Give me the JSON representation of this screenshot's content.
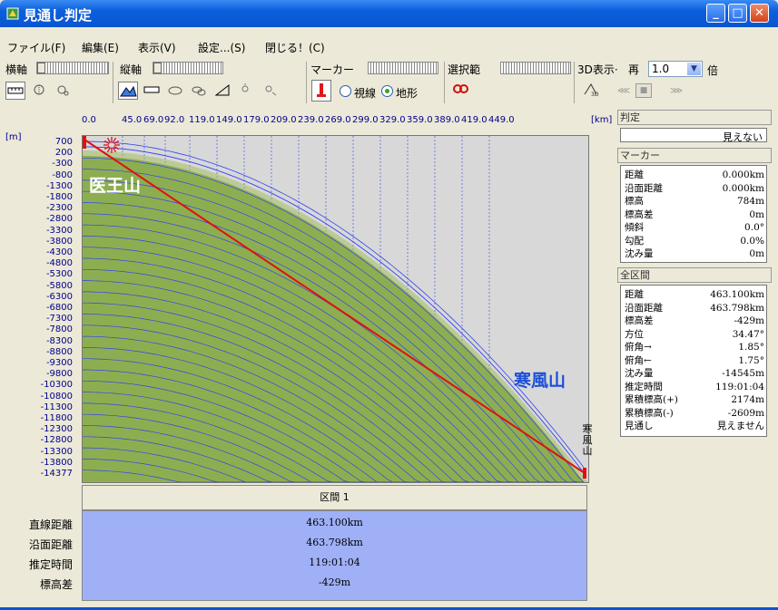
{
  "window": {
    "title": "見通し判定",
    "minimize": "_",
    "maximize": "□",
    "close": "✕"
  },
  "menu": [
    "ファイル(F)",
    "編集(E)",
    "表示(V)",
    "設定...(S)",
    "閉じる！(C)"
  ],
  "toolbar": {
    "h_axis_label": "横軸",
    "v_axis_label": "縦軸",
    "marker_label": "マーカー",
    "select_range_label": "選択範",
    "d3_label": "3D表示·",
    "replay_label": "再",
    "scale_value": "1.0",
    "scale_unit": "倍",
    "radio_line_of_sight": "視線",
    "radio_terrain": "地形",
    "radio_selected": "terrain"
  },
  "chart_data": {
    "type": "line",
    "x_unit": "[km]",
    "y_unit": "[m]",
    "x_ticks": [
      "0.0",
      "45.0",
      "69.0",
      "92.0",
      "119.0",
      "149.0",
      "179.0",
      "209.0",
      "239.0",
      "269.0",
      "299.0",
      "329.0",
      "359.0",
      "389.0",
      "419.0",
      "449.0"
    ],
    "y_ticks": [
      "700",
      "200",
      "-300",
      "-800",
      "-1300",
      "-1800",
      "-2300",
      "-2800",
      "-3300",
      "-3800",
      "-4300",
      "-4800",
      "-5300",
      "-5800",
      "-6300",
      "-6800",
      "-7300",
      "-7800",
      "-8300",
      "-8800",
      "-9300",
      "-9800",
      "-10300",
      "-10800",
      "-11300",
      "-11800",
      "-12300",
      "-12800",
      "-13300",
      "-13800",
      "-14377"
    ],
    "ylim": [
      -14377,
      784
    ],
    "xlim": [
      0,
      463.1
    ],
    "start_peak": "医王山",
    "end_peak": "寒風山",
    "end_peak_vertical": "寒風山",
    "colors": {
      "terrain": "#6f9a3a",
      "terrain_light": "#a6c062",
      "sight_line": "#e01010",
      "grid": "#3344ee"
    }
  },
  "segment_table": {
    "header": "区間 1",
    "rows": [
      {
        "label": "直線距離",
        "value": "463.100km"
      },
      {
        "label": "沿面距離",
        "value": "463.798km"
      },
      {
        "label": "推定時間",
        "value": "119:01:04"
      },
      {
        "label": "標高差",
        "value": "-429m"
      }
    ]
  },
  "right_panel": {
    "judgement_title": "判定",
    "judgement_value": "見えない",
    "marker_title": "マーカー",
    "marker_rows": [
      {
        "k": "距離",
        "v": "0.000km"
      },
      {
        "k": "沿面距離",
        "v": "0.000km"
      },
      {
        "k": "標高",
        "v": "784m"
      },
      {
        "k": "標高差",
        "v": "0m"
      },
      {
        "k": "傾斜",
        "v": "0.0°"
      },
      {
        "k": "勾配",
        "v": "0.0%"
      },
      {
        "k": "沈み量",
        "v": "0m"
      }
    ],
    "all_title": "全区間",
    "all_rows": [
      {
        "k": "距離",
        "v": "463.100km"
      },
      {
        "k": "沿面距離",
        "v": "463.798km"
      },
      {
        "k": "標高差",
        "v": "-429m"
      },
      {
        "k": "方位",
        "v": "34.47°"
      },
      {
        "k": "俯角→",
        "v": "1.85°"
      },
      {
        "k": "俯角←",
        "v": "1.75°"
      },
      {
        "k": "沈み量",
        "v": "-14545m"
      },
      {
        "k": "推定時間",
        "v": "119:01:04"
      },
      {
        "k": "累積標高(+)",
        "v": "2174m"
      },
      {
        "k": "累積標高(-)",
        "v": "-2609m"
      },
      {
        "k": "見通し",
        "v": "見えません"
      }
    ]
  }
}
